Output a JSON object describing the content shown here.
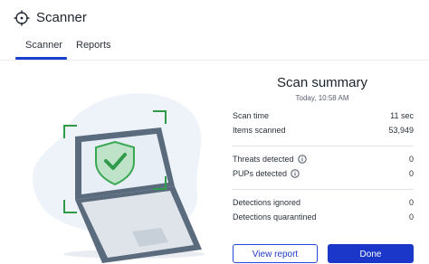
{
  "app": {
    "title": "Scanner",
    "icon": "crosshair-icon"
  },
  "tabs": [
    {
      "label": "Scanner",
      "active": true
    },
    {
      "label": "Reports",
      "active": false
    }
  ],
  "summary": {
    "title": "Scan summary",
    "timestamp": "Today, 10:58 AM",
    "rows": [
      {
        "label": "Scan time",
        "value": "11 sec"
      },
      {
        "label": "Items scanned",
        "value": "53,949"
      },
      {
        "label": "Threats detected",
        "value": "0",
        "info": true
      },
      {
        "label": "PUPs detected",
        "value": "0",
        "info": true
      },
      {
        "label": "Detections ignored",
        "value": "0"
      },
      {
        "label": "Detections quarantined",
        "value": "0"
      }
    ]
  },
  "buttons": {
    "view_report": "View report",
    "done": "Done"
  },
  "colors": {
    "accent": "#1a37c9",
    "shield_green": "#3aa853",
    "laptop": "#5b6b7e",
    "bracket": "#2f9a4a"
  }
}
